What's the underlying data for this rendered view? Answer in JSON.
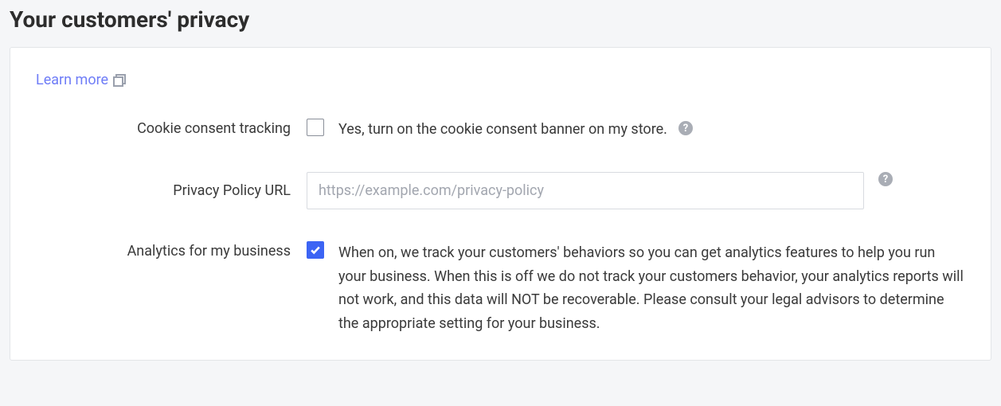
{
  "page": {
    "title": "Your customers' privacy"
  },
  "learn_more": {
    "label": "Learn more"
  },
  "fields": {
    "cookie_consent": {
      "label": "Cookie consent tracking",
      "checkbox_label": "Yes, turn on the cookie consent banner on my store.",
      "checked": false
    },
    "privacy_policy": {
      "label": "Privacy Policy URL",
      "placeholder": "https://example.com/privacy-policy",
      "value": ""
    },
    "analytics": {
      "label": "Analytics for my business",
      "checked": true,
      "description": "When on, we track your customers' behaviors so you can get analytics features to help you run your business. When this is off we do not track your customers behavior, your analytics reports will not work, and this data will NOT be recoverable. Please consult your legal advisors to determine the appropriate setting for your business."
    }
  },
  "help_glyph": "?"
}
